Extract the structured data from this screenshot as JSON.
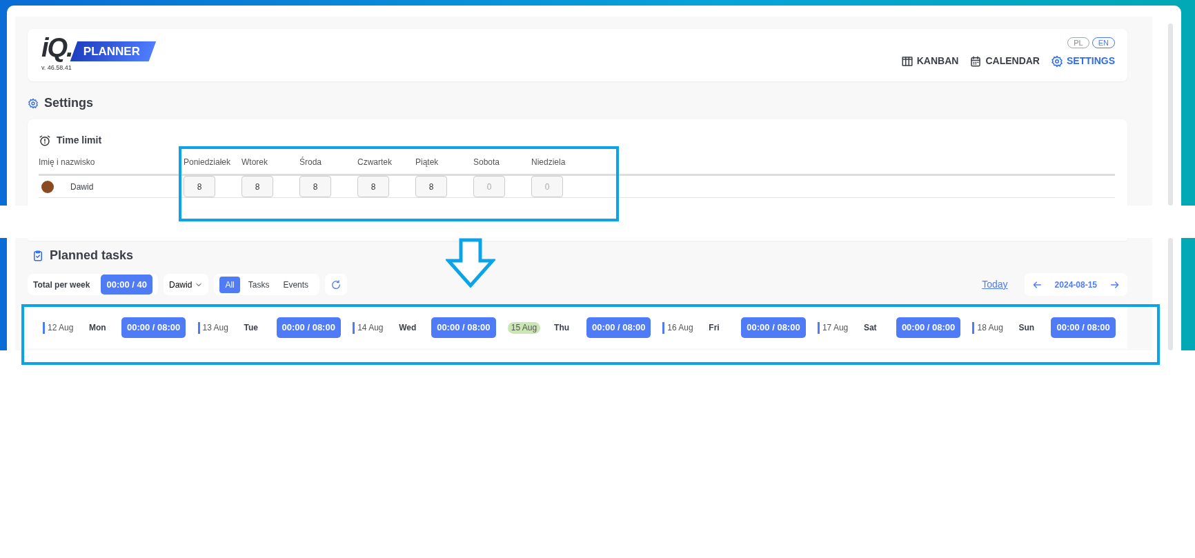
{
  "header": {
    "logo_mark": "iQ.",
    "logo_name": "PLANNER",
    "version": "v. 46.58.41",
    "languages": [
      {
        "label": "PL",
        "selected": false
      },
      {
        "label": "EN",
        "selected": true
      }
    ],
    "nav": [
      {
        "kind": "kanban",
        "label": "KANBAN",
        "selected": false
      },
      {
        "kind": "calendar",
        "label": "CALENDAR",
        "selected": false
      },
      {
        "kind": "settings",
        "label": "SETTINGS",
        "selected": true
      }
    ]
  },
  "settings": {
    "title": "Settings",
    "time_limit": {
      "title": "Time limit",
      "columns": [
        "Imię i nazwisko",
        "Poniedziałek",
        "Wtorek",
        "Środa",
        "Czwartek",
        "Piątek",
        "Sobota",
        "Niedziela"
      ],
      "rows": [
        {
          "name": "Dawid",
          "values": [
            {
              "value": "8",
              "disabled": false
            },
            {
              "value": "8",
              "disabled": false
            },
            {
              "value": "8",
              "disabled": false
            },
            {
              "value": "8",
              "disabled": false
            },
            {
              "value": "8",
              "disabled": false
            },
            {
              "placeholder": "0"
            },
            {
              "placeholder": "0"
            }
          ]
        }
      ]
    }
  },
  "planned_tasks": {
    "title": "Planned tasks",
    "total_label": "Total per week",
    "total": "00:00 / 40",
    "user": "Dawid",
    "filters": [
      {
        "label": "All",
        "selected": true
      },
      {
        "label": "Tasks",
        "selected": false
      },
      {
        "label": "Events",
        "selected": false
      }
    ],
    "today": "Today",
    "date": "2024-08-15",
    "days": [
      {
        "date": "12 Aug",
        "day": "Mon",
        "time": "00:00 / 08:00",
        "today": false
      },
      {
        "date": "13 Aug",
        "day": "Tue",
        "time": "00:00 / 08:00",
        "today": false
      },
      {
        "date": "14 Aug",
        "day": "Wed",
        "time": "00:00 / 08:00",
        "today": false
      },
      {
        "date": "15 Aug",
        "day": "Thu",
        "time": "00:00 / 08:00",
        "today": true
      },
      {
        "date": "16 Aug",
        "day": "Fri",
        "time": "00:00 / 08:00",
        "today": false
      },
      {
        "date": "17 Aug",
        "day": "Sat",
        "time": "00:00 / 08:00",
        "today": false
      },
      {
        "date": "18 Aug",
        "day": "Sun",
        "time": "00:00 / 08:00",
        "today": false
      }
    ]
  }
}
